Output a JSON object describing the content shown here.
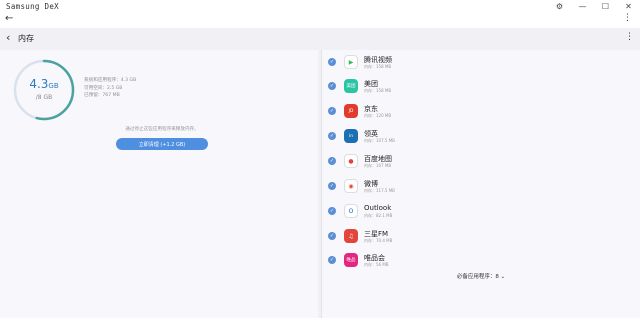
{
  "window": {
    "title": "Samsung DeX"
  },
  "header": {
    "title": "内存"
  },
  "memory": {
    "used": "4.3",
    "used_unit": "GB",
    "total": "/8 GB",
    "stats": [
      "系统和应用程序：4.3 GB",
      "可用空间：2.5 GB",
      "已预留：767 MB"
    ],
    "notice": "通过停止这些应用程序来释放内存。",
    "clean_button": "立即清理 (+1.2 GB)",
    "used_fraction": 0.54
  },
  "apps": [
    {
      "name": "腾讯视频",
      "size": "内存：158 MB",
      "icon": "tencent-video-icon",
      "color": "#ffffff",
      "glyph": "▶",
      "glyph_color": "#2bbd5e"
    },
    {
      "name": "美团",
      "size": "内存：158 MB",
      "icon": "meituan-icon",
      "color": "#2cc5a4",
      "glyph": "美团",
      "glyph_color": "#ffffff"
    },
    {
      "name": "京东",
      "size": "内存：120 MB",
      "icon": "jd-icon",
      "color": "#e23b2e",
      "glyph": "JD",
      "glyph_color": "#ffffff"
    },
    {
      "name": "领英",
      "size": "内存：107.5 MB",
      "icon": "linkedin-icon",
      "color": "#1b6fb3",
      "glyph": "in",
      "glyph_color": "#ffffff"
    },
    {
      "name": "百度地图",
      "size": "内存：107 MB",
      "icon": "baidu-map-icon",
      "color": "#ffffff",
      "glyph": "●",
      "glyph_color": "#e2453c"
    },
    {
      "name": "微博",
      "size": "内存：117.5 MB",
      "icon": "weibo-icon",
      "color": "#ffffff",
      "glyph": "◉",
      "glyph_color": "#e8472e"
    },
    {
      "name": "Outlook",
      "size": "内存：82.1 MB",
      "icon": "outlook-icon",
      "color": "#ffffff",
      "glyph": "O",
      "glyph_color": "#0f68c4"
    },
    {
      "name": "三星FM",
      "size": "内存：70.4 MB",
      "icon": "samsung-fm-icon",
      "color": "#e2453c",
      "glyph": "♫",
      "glyph_color": "#ffffff"
    },
    {
      "name": "唯品会",
      "size": "内存：56 MB",
      "icon": "vip-icon",
      "color": "#e3277f",
      "glyph": "唯品",
      "glyph_color": "#ffffff"
    }
  ],
  "footer": {
    "text": "必备应用程序：8 ⌄"
  }
}
